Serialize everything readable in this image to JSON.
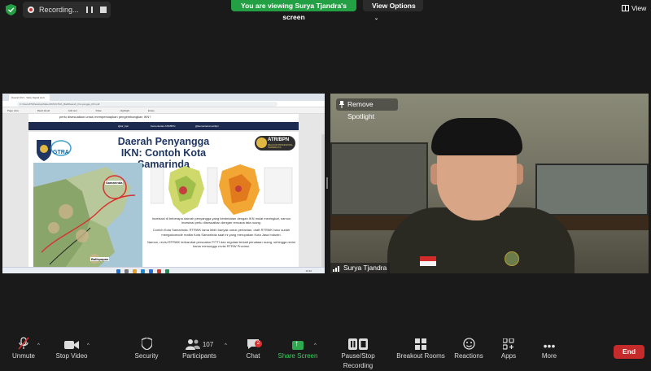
{
  "topbar": {
    "recording_label": "Recording...",
    "viewing_banner": "You are viewing Surya Tjandra's screen",
    "view_options_label": "View Options",
    "view_label": "View"
  },
  "shared_screen": {
    "browser_tab": "Daerah IKN - Slide Digital Hub",
    "url": "C:/Users/PS/Desktop/Materi/IKN/GTRA_Bali/Daerah_Penyangga_IKN.pdf",
    "pdf_toolbar": [
      "Page view",
      "Read aloud",
      "Add text",
      "Draw",
      "Highlight",
      "Erase"
    ],
    "slide_top_text": "perlu disesuaikan untuk mempersiapkan pengembangkan IKN?",
    "slide_top_social": [
      "@atr_bpn",
      "Kementerian ATR/BPN",
      "@kementerian.atrbpn"
    ],
    "slide_title": "Daerah Penyangga IKN: Contoh Kota Samarinda",
    "gtra_logo": "GTRA",
    "ministry_logo": "ATR/BPN",
    "ministry_sub": "MELAYANI PROFESIONAL TERPERCAYA",
    "map_labels": [
      "Samarinda",
      "Balikpapan"
    ],
    "paragraphs": [
      "Investasi di beberapa daerah penyangga yang berdekatan dengan IKN mulai meningkat, namun investasi perlu disesuaikan dengan rencana tata ruang.",
      "Contoh Kota Samarinda: RTRWK lama lebih banyak untuk pertanian, draft RTRWK baru sudah mengakomodir realita Kota Samarinda saat ini yang merupakan Kota Jasa Industri.",
      "Namun, revisi RTRWK terhambat persoalan P/TTI dan regulasi terkait penataan ruang, sehingga revisi harus menunggu revisi RTRW Provinsi."
    ],
    "taskbar_time": "13:12"
  },
  "video": {
    "remove_spotlight_label": "Remove Spotlight",
    "participant_name": "Surya Tjandra"
  },
  "toolbar": {
    "unmute_label": "Unmute",
    "stop_video_label": "Stop Video",
    "security_label": "Security",
    "participants_label": "Participants",
    "participants_count": "107",
    "chat_label": "Chat",
    "chat_badge": "2",
    "share_screen_label": "Share Screen",
    "record_label": "Pause/Stop Recording",
    "breakout_label": "Breakout Rooms",
    "reactions_label": "Reactions",
    "apps_label": "Apps",
    "more_label": "More",
    "end_label": "End"
  },
  "colors": {
    "accent_green": "#23a043",
    "end_red": "#c62b2b",
    "slide_title_blue": "#1f3562"
  }
}
